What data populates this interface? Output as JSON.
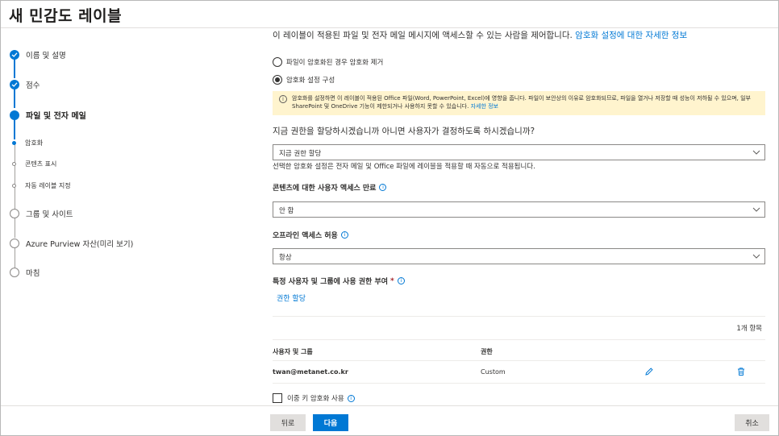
{
  "header": {
    "title": "새 민감도 레이블"
  },
  "stepper": {
    "steps": [
      {
        "label": "이름 및 설명",
        "state": "done"
      },
      {
        "label": "점수",
        "state": "done"
      },
      {
        "label": "파일 및 전자 메일",
        "state": "current"
      },
      {
        "label": "그룹 및 사이트",
        "state": "todo"
      },
      {
        "label": "Azure Purview 자산(미리 보기)",
        "state": "todo"
      },
      {
        "label": "마침",
        "state": "todo"
      }
    ],
    "substeps": [
      {
        "label": "암호화",
        "state": "current"
      },
      {
        "label": "콘텐츠 표시",
        "state": "todo"
      },
      {
        "label": "자동 레이블 지정",
        "state": "todo"
      }
    ]
  },
  "main": {
    "intro_text": "이 레이블이 적용된 파일 및 전자 메일 메시지에 액세스할 수 있는 사람을 제어합니다.",
    "intro_link": "암호화 설정에 대한 자세한 정보",
    "radio_remove": "파일이 암호화된 경우 암호화 제거",
    "radio_configure": "암호화 설정 구성",
    "warning_text": "암호화를 설정하면 이 레이블이 적용된 Office 파일(Word, PowerPoint, Excel)에 영향을 줍니다. 파일이 보안상의 이유로 암호화되므로, 파일을 열거나 저장할 때 성능이 저하될 수 있으며, 일부 SharePoint 및 OneDrive 기능이 제한되거나 사용하지 못할 수 있습니다.",
    "warning_link": "자세한 정보",
    "question": "지금 권한을 할당하시겠습니까 아니면 사용자가 결정하도록 하시겠습니까?",
    "assign_select": "지금 권한 할당",
    "helper_text": "선택한 암호화 설정은 전자 메일 및 Office 파일에 레이블을 적용할 때 자동으로 적용됩니다.",
    "expire_label": "콘텐츠에 대한 사용자 액세스 만료",
    "expire_select": "안 함",
    "offline_label": "오프라인 액세스 허용",
    "offline_select": "항상",
    "users_label": "특정 사용자 및 그룹에 사용 권한 부여",
    "required_mark": "*",
    "assign_link": "권한 할당",
    "item_count": "1개 항목",
    "table": {
      "col_users": "사용자 및 그룹",
      "col_perm": "권한",
      "rows": [
        {
          "user": "twan@metanet.co.kr",
          "perm": "Custom"
        }
      ]
    },
    "double_key": "이중 키 암호화 사용"
  },
  "footer": {
    "back": "뒤로",
    "next": "다음",
    "cancel": "취소"
  },
  "colors": {
    "accent": "#0078d4",
    "warning_bg": "#fff4ce"
  }
}
